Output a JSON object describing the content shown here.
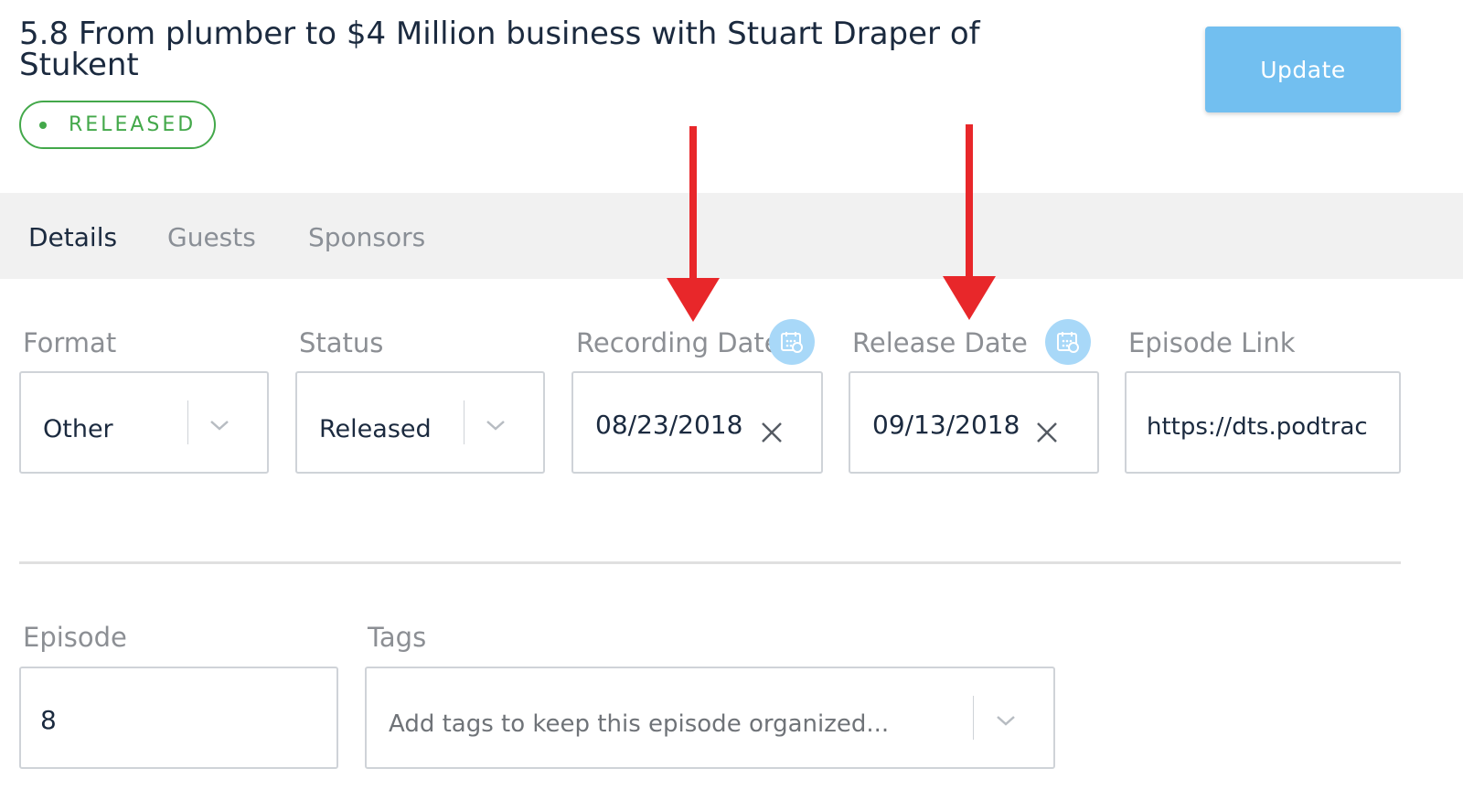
{
  "episode": {
    "title": "5.8 From plumber to $4 Million business with Stuart Draper of Stukent",
    "status_badge": "RELEASED"
  },
  "header": {
    "update_label": "Update"
  },
  "tabs": [
    {
      "label": "Details",
      "active": true
    },
    {
      "label": "Guests",
      "active": false
    },
    {
      "label": "Sponsors",
      "active": false
    }
  ],
  "form": {
    "format": {
      "label": "Format",
      "value": "Other"
    },
    "status": {
      "label": "Status",
      "value": "Released"
    },
    "recording_date": {
      "label": "Recording Date",
      "value": "08/23/2018"
    },
    "release_date": {
      "label": "Release Date",
      "value": "09/13/2018"
    },
    "episode_link": {
      "label": "Episode Link",
      "value": "https://dts.podtrac"
    },
    "episode_number": {
      "label": "Episode",
      "value": "8"
    },
    "tags": {
      "label": "Tags",
      "placeholder": "Add tags to keep this episode organized..."
    }
  },
  "icons": {
    "chevron": "chevron-down-icon",
    "clear": "close-icon",
    "calendar": "calendar-icon",
    "annotation": "red-arrow"
  },
  "colors": {
    "accent": "#72bff0",
    "status_green": "#43a84a",
    "annotation_red": "#e8272a",
    "text_dark": "#1b2a3f"
  }
}
